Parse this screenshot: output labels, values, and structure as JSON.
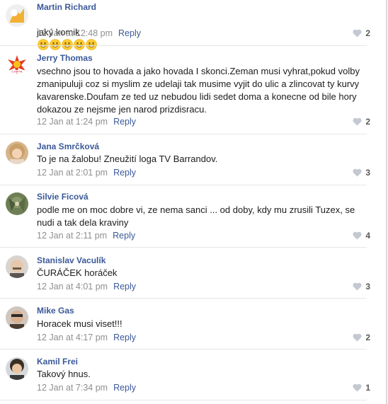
{
  "colors": {
    "link": "#3b5998",
    "meta": "#8f8f8f",
    "heart": "#c3c8d2"
  },
  "comments": [
    {
      "author": "Martin Richard",
      "avatar": "avatar-martin-richard",
      "text": "jaký komik",
      "emoji_count": 5,
      "time": "12 Jan at 12:48 pm",
      "reply": "Reply",
      "likes": "2"
    },
    {
      "author": "Jerry Thomas",
      "avatar": "avatar-jerry-thomas",
      "text": "vsechno jsou to hovada a jako hovada I skonci.Zeman musi vyhrat,pokud volby\nzmanipuluji coz si myslim ze udelaji tak musime vyjit do ulic a zlincovat ty kurvy\nkavarenske.Doufam ze ted uz nebudou lidi sedet doma a konecne od bile hory\ndokazou ze nejsme jen narod prizdisracu.",
      "time": "12 Jan at 1:24 pm",
      "reply": "Reply",
      "likes": "2"
    },
    {
      "author": "Jana Smrčková",
      "avatar": "avatar-jana-smrckova",
      "text": "To je na žalobu! Zneužití loga TV Barrandov.",
      "time": "12 Jan at 2:01 pm",
      "reply": "Reply",
      "likes": "3"
    },
    {
      "author": "Silvie Ficová",
      "avatar": "avatar-silvie-ficova",
      "text": "podle me on moc dobre vi, ze nema sanci ... od doby, kdy mu zrusili Tuzex, se\nnudi a tak dela kraviny",
      "time": "12 Jan at 2:11 pm",
      "reply": "Reply",
      "likes": "4"
    },
    {
      "author": "Stanislav Vaculík",
      "avatar": "avatar-stanislav-vaculik",
      "text": "ČURÁČEK horáček",
      "time": "12 Jan at 4:01 pm",
      "reply": "Reply",
      "likes": "3"
    },
    {
      "author": "Mike Gas",
      "avatar": "avatar-mike-gas",
      "text": "Horacek musi viset!!!",
      "time": "12 Jan at 4:17 pm",
      "reply": "Reply",
      "likes": "2"
    },
    {
      "author": "Kamil Frei",
      "avatar": "avatar-kamil-frei",
      "text": "Takový hnus.",
      "time": "12 Jan at 7:34 pm",
      "reply": "Reply",
      "likes": "1"
    }
  ]
}
